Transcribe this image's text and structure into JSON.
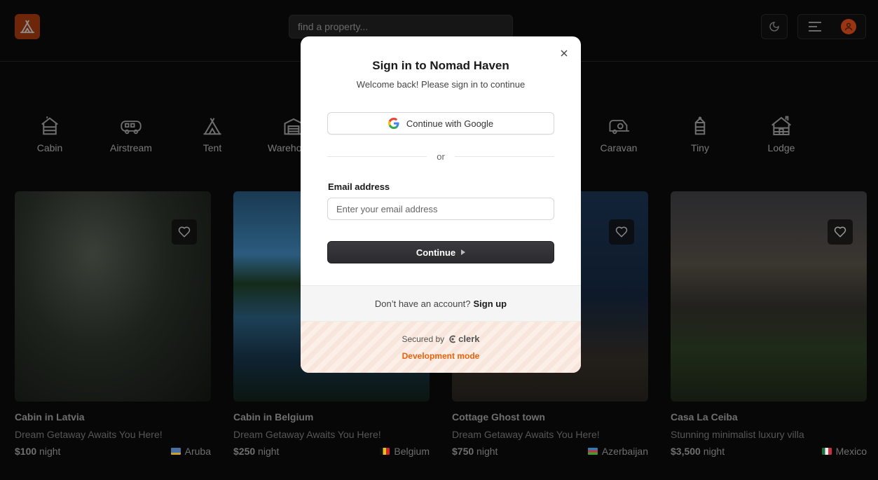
{
  "header": {
    "search_placeholder": "find a property...",
    "logo_icon": "tent-icon",
    "theme_icon": "moon-icon",
    "menu_icon": "hamburger-icon",
    "avatar_icon": "user-icon"
  },
  "categories": [
    {
      "label": "Cabin",
      "icon": "cabin-icon"
    },
    {
      "label": "Airstream",
      "icon": "airstream-icon"
    },
    {
      "label": "Tent",
      "icon": "tent-icon"
    },
    {
      "label": "Wareho",
      "icon": "warehouse-icon"
    },
    {
      "label": "Caravan",
      "icon": "caravan-icon"
    },
    {
      "label": "Tiny",
      "icon": "tiny-house-icon"
    },
    {
      "label": "Lodge",
      "icon": "lodge-icon"
    }
  ],
  "listings": [
    {
      "name": "Cabin in Latvia",
      "tagline": "Dream Getaway Awaits You Here!",
      "price": "$100",
      "unit": "night",
      "country": "Aruba"
    },
    {
      "name": "Cabin in Belgium",
      "tagline": "Dream Getaway Awaits You Here!",
      "price": "$250",
      "unit": "night",
      "country": "Belgium"
    },
    {
      "name": "Cottage Ghost town",
      "tagline": "Dream Getaway Awaits You Here!",
      "price": "$750",
      "unit": "night",
      "country": "Azerbaijan"
    },
    {
      "name": "Casa La Ceiba",
      "tagline": "Stunning minimalist luxury villa",
      "price": "$3,500",
      "unit": "night",
      "country": "Mexico"
    }
  ],
  "modal": {
    "title": "Sign in to Nomad Haven",
    "subtitle": "Welcome back! Please sign in to continue",
    "google_label": "Continue with Google",
    "divider": "or",
    "email_label": "Email address",
    "email_placeholder": "Enter your email address",
    "continue_label": "Continue",
    "no_account": "Don’t have an account?",
    "signup_link": "Sign up",
    "secured_by": "Secured by",
    "clerk_brand": "clerk",
    "dev_mode": "Development mode"
  },
  "colors": {
    "brand": "#c2410c",
    "dev_mode": "#e8620b",
    "button_dark": "#2b2b2e"
  }
}
